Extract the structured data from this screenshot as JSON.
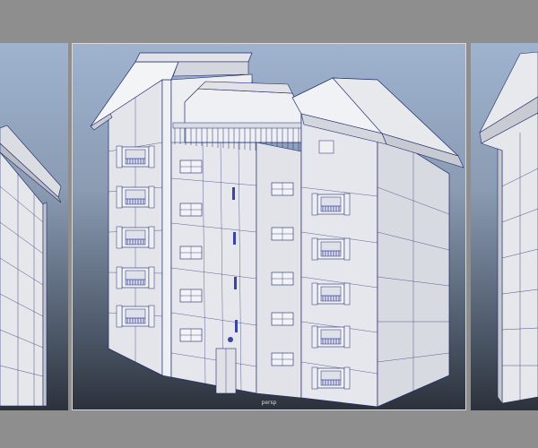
{
  "viewports": {
    "left": {
      "name": "left-viewport"
    },
    "center": {
      "name": "perspective-viewport",
      "camera_label": "persp"
    },
    "right": {
      "name": "right-viewport"
    }
  },
  "model": {
    "wire_color": "#1e2a6e",
    "surface_color": "#e9eaee",
    "shade_color": "#c9ccd3",
    "railing_color": "#3a43a8"
  },
  "colors": {
    "background": "#8e8e8e",
    "viewport_top": "#9fb3cf",
    "viewport_bottom": "#2c323b"
  }
}
